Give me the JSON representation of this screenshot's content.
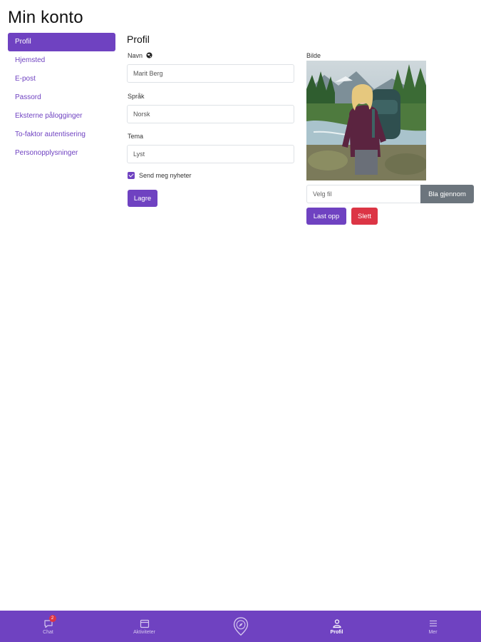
{
  "page": {
    "title": "Min konto"
  },
  "sidebar": {
    "items": [
      {
        "label": "Profil",
        "active": true
      },
      {
        "label": "Hjemsted"
      },
      {
        "label": "E-post"
      },
      {
        "label": "Passord"
      },
      {
        "label": "Eksterne pålogginger"
      },
      {
        "label": "To-faktor autentisering"
      },
      {
        "label": "Personopplysninger"
      }
    ]
  },
  "profile": {
    "section_title": "Profil",
    "name_label": "Navn",
    "name_value": "Marit Berg",
    "language_label": "Språk",
    "language_value": "Norsk",
    "theme_label": "Tema",
    "theme_value": "Lyst",
    "newsletter_label": "Send meg nyheter",
    "newsletter_checked": true,
    "save_label": "Lagre"
  },
  "picture": {
    "label": "Bilde",
    "file_placeholder": "Velg fil",
    "browse_label": "Bla gjennom",
    "upload_label": "Last opp",
    "delete_label": "Slett"
  },
  "bottom_nav": {
    "items": [
      {
        "label": "Chat",
        "icon": "chat-icon",
        "badge": "2"
      },
      {
        "label": "Aktiviteter",
        "icon": "calendar-icon"
      },
      {
        "label": "",
        "icon": "compass-pin-icon"
      },
      {
        "label": "Profil",
        "icon": "person-icon",
        "active": true
      },
      {
        "label": "Mer",
        "icon": "menu-icon"
      }
    ]
  },
  "colors": {
    "accent": "#6f42c1",
    "danger": "#dc3545",
    "secondary": "#6c757d"
  }
}
